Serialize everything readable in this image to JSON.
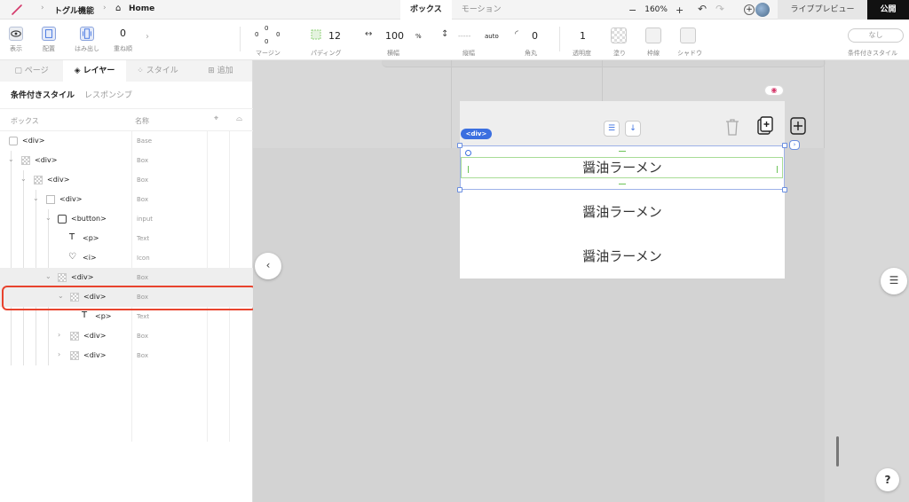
{
  "topbar": {
    "breadcrumb": [
      "トグル機能",
      "Home"
    ],
    "tabs": [
      {
        "label": "ボックス",
        "active": true
      },
      {
        "label": "モーション",
        "active": false
      }
    ],
    "zoom": "160%",
    "zoom_minus": "−",
    "zoom_plus": "+",
    "preview_label": "ライブプレビュー",
    "publish_label": "公開"
  },
  "toolbar": {
    "view_label": "表示",
    "align_label": "配置",
    "overflow_label": "はみ出し",
    "order_value": "0",
    "order_label": "重ね順",
    "margin_top": "0",
    "margin_left": "0",
    "margin_right": "0",
    "margin_bottom": "0",
    "margin_label": "マージン",
    "padding_value": "12",
    "padding_label": "パディング",
    "width_value": "100",
    "width_unit": "%",
    "width_label": "横幅",
    "height_value": "-----",
    "height_unit": "auto",
    "height_label": "縦幅",
    "radius_value": "0",
    "radius_label": "角丸",
    "opacity_value": "1",
    "opacity_label": "透明度",
    "fill_label": "塗り",
    "border_label": "枠線",
    "shadow_label": "シャドウ",
    "conditional_value": "なし",
    "conditional_label": "条件付きスタイル"
  },
  "panel": {
    "tabs": [
      "ページ",
      "レイヤー",
      "スタイル",
      "追加"
    ],
    "active_tab": "レイヤー",
    "subtabs": [
      "条件付きスタイル",
      "レスポンシブ"
    ],
    "header": {
      "box": "ボックス",
      "name": "名称"
    },
    "rows": [
      {
        "tag": "<div>",
        "type": "Base",
        "indent": 0
      },
      {
        "tag": "<div>",
        "type": "Box",
        "indent": 1
      },
      {
        "tag": "<div>",
        "type": "Box",
        "indent": 2
      },
      {
        "tag": "<div>",
        "type": "Box",
        "indent": 3
      },
      {
        "tag": "<button>",
        "type": "input",
        "indent": 4
      },
      {
        "tag": "<p>",
        "type": "Text",
        "indent": 5
      },
      {
        "tag": "<i>",
        "type": "Icon",
        "indent": 5
      },
      {
        "tag": "<div>",
        "type": "Box",
        "indent": 4
      },
      {
        "tag": "<div>",
        "type": "Box",
        "indent": 5
      },
      {
        "tag": "<p>",
        "type": "Text",
        "indent": 6
      },
      {
        "tag": "<div>",
        "type": "Box",
        "indent": 5
      },
      {
        "tag": "<div>",
        "type": "Box",
        "indent": 5
      }
    ]
  },
  "canvas": {
    "selected_tag": "<div>",
    "items": [
      "醤油ラーメン",
      "醤油ラーメン",
      "醤油ラーメン"
    ]
  },
  "colors": {
    "accent": "#3b6fe0",
    "highlight": "#e8432e",
    "publish_bg": "#111111"
  }
}
